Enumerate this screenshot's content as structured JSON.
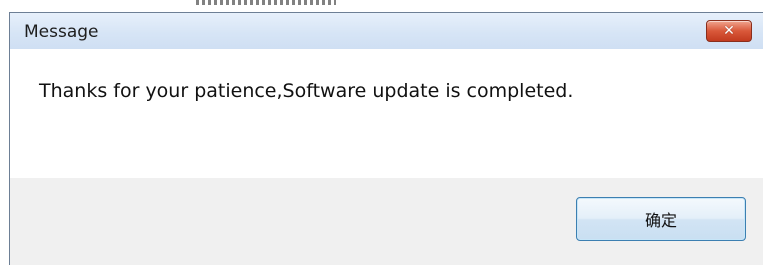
{
  "dialog": {
    "title": "Message",
    "close_icon": "close-icon",
    "message": "Thanks for your patience,Software update is completed.",
    "ok_button_label": "确定"
  },
  "colors": {
    "titlebar": "#d7e5f6",
    "close_button": "#d9583a",
    "footer": "#f0f0f0",
    "ok_button_border": "#3c7fb1"
  }
}
